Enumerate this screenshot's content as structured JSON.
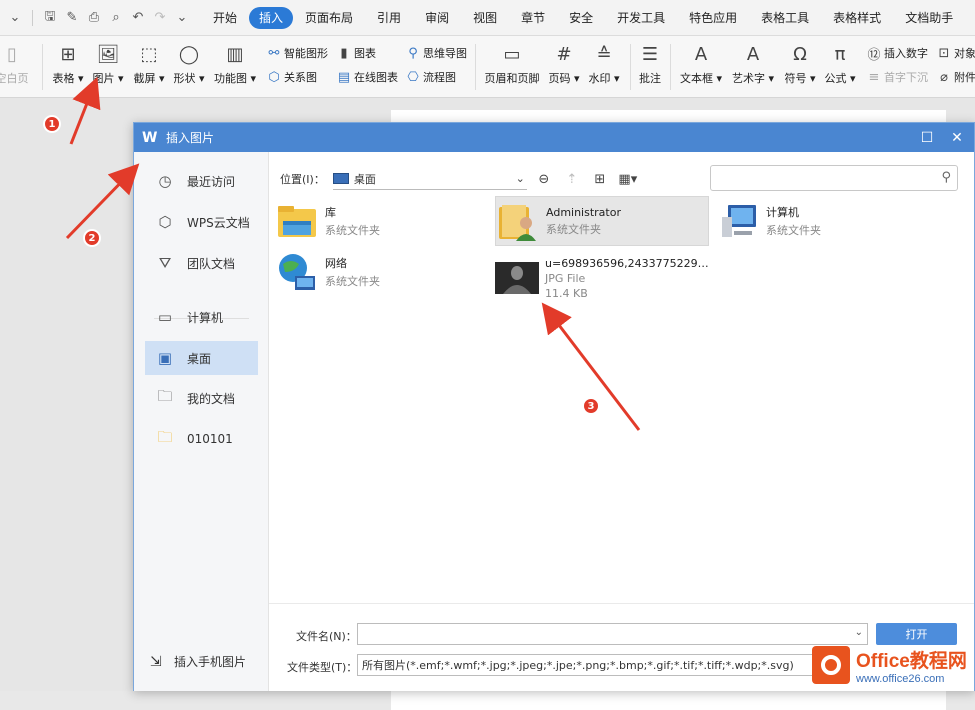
{
  "menu": {
    "tabs": [
      "开始",
      "插入",
      "页面布局",
      "引用",
      "审阅",
      "视图",
      "章节",
      "安全",
      "开发工具",
      "特色应用",
      "表格工具",
      "表格样式",
      "文档助手"
    ],
    "active_index": 1
  },
  "ribbon": {
    "blank_page": "空白页",
    "table": "表格",
    "picture": "图片",
    "screenshot": "截屏",
    "shape": "形状",
    "function_chart": "功能图",
    "smart_graphic": "智能图形",
    "chart": "图表",
    "mind_map": "思维导图",
    "relation_chart": "关系图",
    "online_chart": "在线图表",
    "flowchart": "流程图",
    "header_footer": "页眉和页脚",
    "page_number": "页码",
    "watermark": "水印",
    "comment": "批注",
    "text_box": "文本框",
    "word_art": "艺术字",
    "symbol": "符号",
    "formula": "公式",
    "insert_number": "插入数字",
    "drop_cap": "首字下沉",
    "object": "对象",
    "attachment": "附件"
  },
  "dialog": {
    "title": "插入图片",
    "sidebar": {
      "recent": "最近访问",
      "wps_cloud": "WPS云文档",
      "team_docs": "团队文档",
      "computer": "计算机",
      "desktop": "桌面",
      "my_docs": "我的文档",
      "folder_010101": "010101",
      "insert_mobile": "插入手机图片"
    },
    "location_label": "位置(I)：",
    "location_value": "桌面",
    "files": [
      {
        "name": "库",
        "type": "系统文件夹"
      },
      {
        "name": "Administrator",
        "type": "系统文件夹"
      },
      {
        "name": "计算机",
        "type": "系统文件夹"
      },
      {
        "name": "网络",
        "type": "系统文件夹"
      },
      {
        "name": "u=698936596,2433775229&f...",
        "type": "JPG File",
        "size": "11.4 KB"
      }
    ],
    "filename_label": "文件名(N)：",
    "filename_value": "",
    "filetype_label": "文件类型(T)：",
    "filetype_value": "所有图片(*.emf;*.wmf;*.jpg;*.jpeg;*.jpe;*.png;*.bmp;*.gif;*.tif;*.tiff;*.wdp;*.svg)",
    "open_button": "打开"
  },
  "annotations": {
    "m1": "1",
    "m2": "2",
    "m3": "3",
    "color": "#e23b2a"
  },
  "watermark": {
    "title": "Office教程网",
    "url": "www.office26.com"
  },
  "colors": {
    "accent": "#2b7ad6",
    "dialog_title": "#4a86d1",
    "selected_side": "#cfe0f5"
  }
}
